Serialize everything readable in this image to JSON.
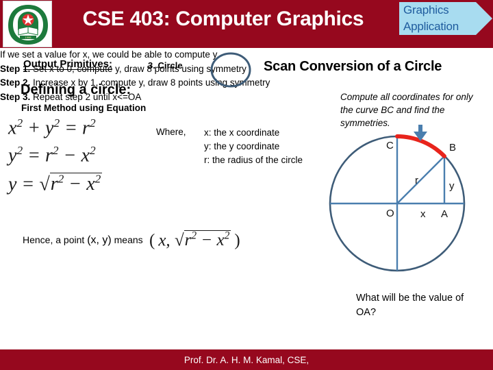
{
  "header": {
    "title": "CSE 403: Computer Graphics",
    "banner_line1": "Graphics",
    "banner_line2": "Application",
    "bar_color": "#96081e",
    "banner_fill": "#a8dcf0",
    "banner_text_color": "#1f5c9e",
    "logo_alt": "university-emblem"
  },
  "slide": {
    "section_label": "Output Primitives:",
    "topic_index": "3. Circle",
    "right_title": "Scan Conversion of a Circle",
    "defining_heading": "Defining a circle:",
    "method_heading": "First Method using Equation",
    "equations": {
      "eq1": "x² + y² = r²",
      "eq2": "y² = r² − x²",
      "eq3": "y = √(r² − x²)"
    },
    "where_label": "Where,",
    "where_items": [
      "x: the x coordinate",
      "y: the y coordinate",
      "r: the radius of the circle"
    ],
    "compute_note": "Compute all coordinates for only the curve BC and find the symmetries.",
    "hence_prefix": "Hence, a point",
    "hence_point": "(x, y)",
    "hence_means": "means",
    "hence_expr": "( x, √(r² − x²) )",
    "lines": [
      "If we set a value for x, we could be able to compute y."
    ],
    "steps": [
      {
        "label": "Step 1.",
        "text": " Set x to 0, compute y, draw 8 points using symmetry"
      },
      {
        "label": "Step 2.",
        "text": " Increase x by 1, compute y, draw 8 points using symmetry"
      },
      {
        "label": "Step 3.",
        "text": " Repeat step 2 until x<=OA"
      }
    ],
    "question": "What will be the value of OA?"
  },
  "diagram": {
    "labels": {
      "center": "O",
      "point_a": "A",
      "point_b": "B",
      "point_c": "C",
      "radius": "r",
      "x_leg": "x",
      "y_leg": "y"
    },
    "circle_color": "#3e5c78",
    "arc_color": "#e8241c",
    "arrow_color": "#4a7eae",
    "line_color": "#4a7eae"
  },
  "footer": {
    "text": "Prof. Dr. A. H. M. Kamal, CSE,"
  }
}
